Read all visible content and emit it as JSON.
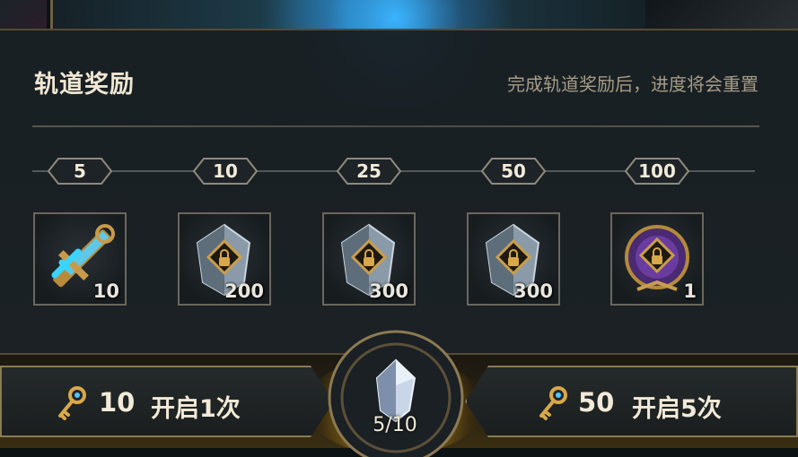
{
  "panel": {
    "title": "轨道奖励",
    "note": "完成轨道奖励后，进度将会重置"
  },
  "milestones": [
    "5",
    "10",
    "25",
    "50",
    "100"
  ],
  "rewards": [
    {
      "icon": "key-sword-icon",
      "count": "10"
    },
    {
      "icon": "locked-crystal-icon",
      "count": "200"
    },
    {
      "icon": "locked-crystal-icon",
      "count": "300"
    },
    {
      "icon": "locked-crystal-icon",
      "count": "300"
    },
    {
      "icon": "locked-orb-icon",
      "count": "1"
    }
  ],
  "buttons": {
    "single": {
      "cost": "10",
      "label": "开启1次"
    },
    "multi": {
      "cost": "50",
      "label": "开启5次"
    }
  },
  "progress": "5/10",
  "colors": {
    "panel_bg": "#1c2226",
    "gold_border": "#8c7a52",
    "text_light": "#f2ead8",
    "note_text": "#a69b86",
    "key_gold": "#d8a84a"
  }
}
